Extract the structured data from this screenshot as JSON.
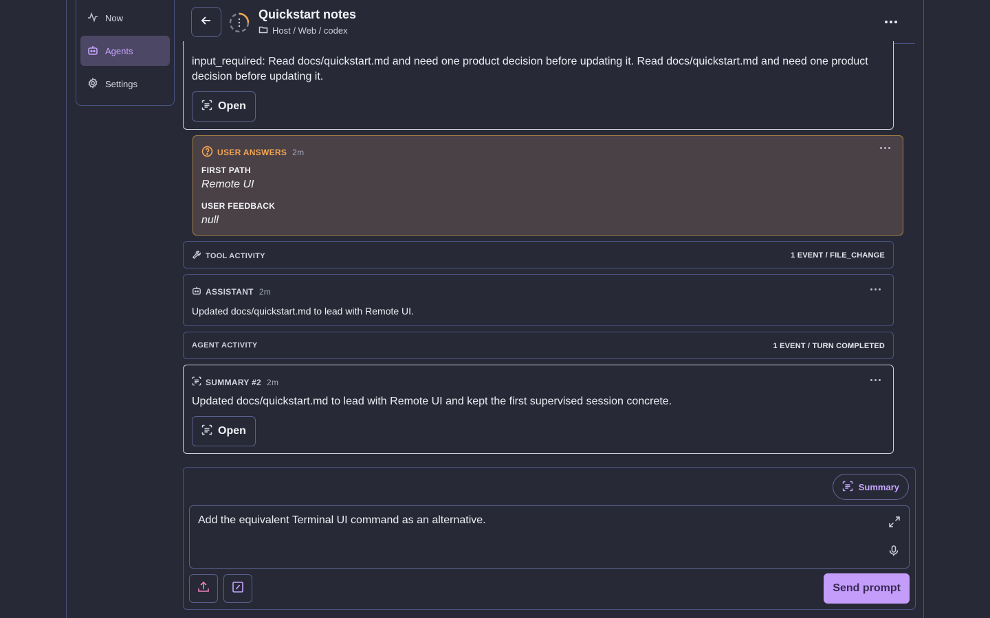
{
  "sidebar": {
    "items": [
      {
        "label": "Now",
        "icon": "activity-icon"
      },
      {
        "label": "Agents",
        "icon": "bot-icon",
        "active": true
      },
      {
        "label": "Settings",
        "icon": "gear-icon"
      }
    ]
  },
  "header": {
    "title": "Quickstart notes",
    "breadcrumb": "Host / Web / codex"
  },
  "timeline": {
    "input_card": {
      "text": "input_required: Read docs/quickstart.md and need one product decision before updating it. Read docs/quickstart.md and need one product decision before updating it.",
      "open_label": "Open"
    },
    "user_answers": {
      "label": "USER ANSWERS",
      "ago": "2m",
      "fields": [
        {
          "label": "FIRST PATH",
          "value": "Remote UI"
        },
        {
          "label": "USER FEEDBACK",
          "value": "null"
        }
      ]
    },
    "tool_activity": {
      "label": "TOOL ACTIVITY",
      "meta": "1 EVENT / FILE_CHANGE"
    },
    "assistant": {
      "label": "ASSISTANT",
      "ago": "2m",
      "text": "Updated docs/quickstart.md to lead with Remote UI."
    },
    "agent_activity": {
      "label": "AGENT ACTIVITY",
      "meta": "1 EVENT / TURN COMPLETED"
    },
    "summary": {
      "label": "SUMMARY #2",
      "ago": "2m",
      "text": "Updated docs/quickstart.md to lead with Remote UI and kept the first supervised session concrete.",
      "open_label": "Open"
    }
  },
  "composer": {
    "summary_chip": "Summary",
    "prompt_value": "Add the equivalent Terminal UI command as an alternative.",
    "send_label": "Send prompt"
  },
  "colors": {
    "accent": "#c49cf9",
    "answers_label": "#f2a653",
    "answers_bg": "#4a4146",
    "border": "#4e5384"
  }
}
